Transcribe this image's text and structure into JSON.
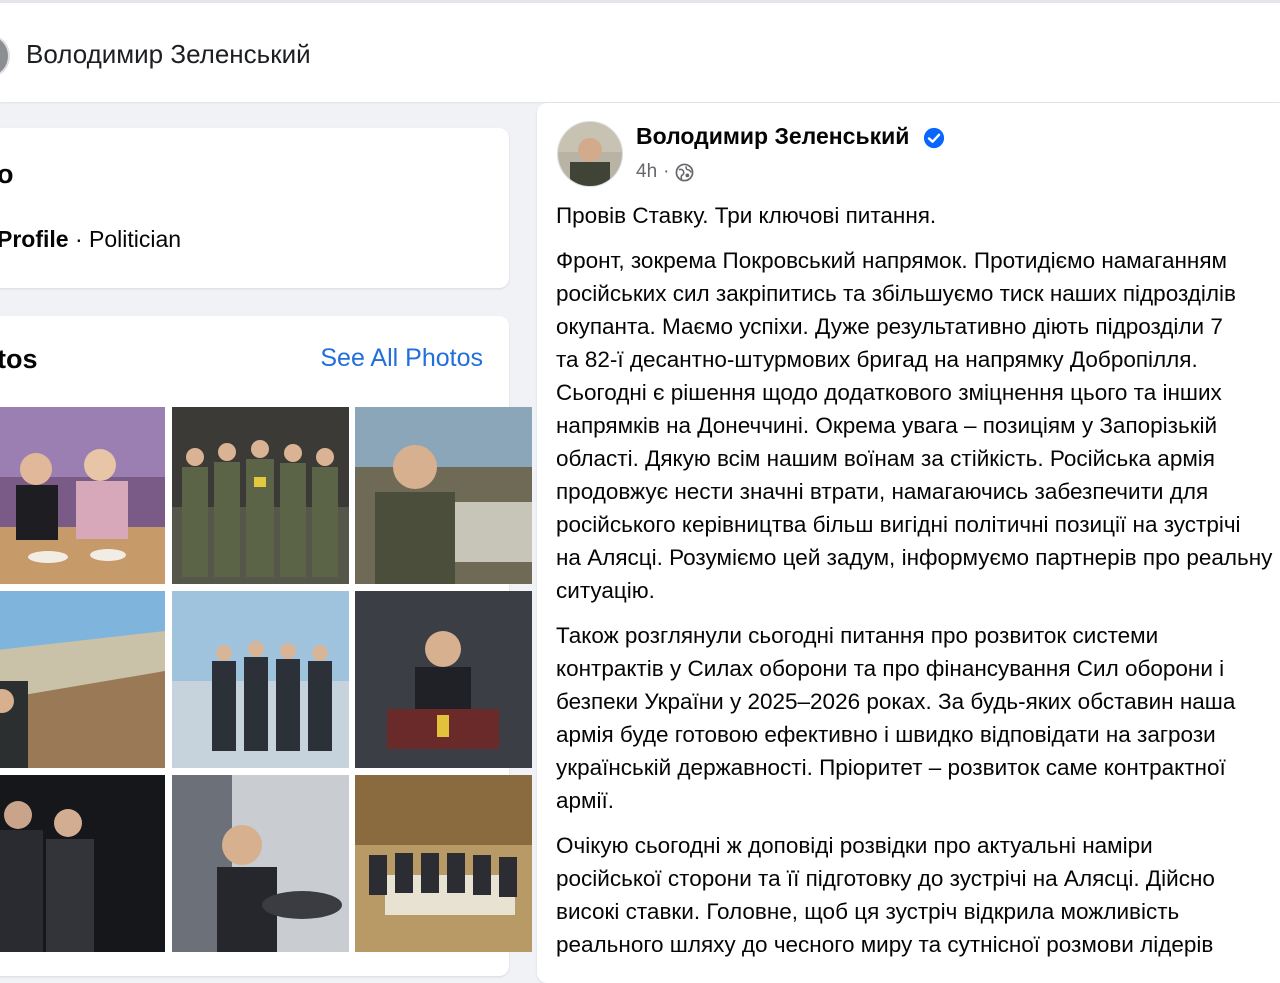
{
  "header": {
    "page_name": "Володимир Зеленський"
  },
  "intro": {
    "heading": "o",
    "profile_type": "Profile",
    "separator": " · ",
    "category": "Politician"
  },
  "photos": {
    "heading": "tos",
    "see_all_label": "See All Photos"
  },
  "post": {
    "author": "Володимир Зеленський",
    "time": "4h",
    "verified_icon": "verified-badge-icon",
    "audience_icon": "globe-icon",
    "accent_color": "#0866ff",
    "paragraphs": [
      [
        "Провів Ставку. Три ключові питання."
      ],
      [
        "Фронт, зокрема Покровський напрямок. Протидіємо намаганням",
        "російських сил закріпитись та збільшуємо тиск наших підрозділів",
        "окупанта. Маємо успіхи. Дуже результативно діють підрозділи 7",
        "та 82-ї десантно-штурмових бригад на напрямку Добропілля.",
        "Сьогодні є рішення щодо додаткового зміцнення цього та інших",
        "напрямків на Донеччині. Окрема увага – позиціям у Запорізькій",
        "області. Дякую всім нашим воїнам за стійкість. Російська армія",
        "продовжує нести значні втрати, намагаючись забезпечити для",
        "російського керівництва більш вигідні політичні позиції на зустрічі",
        "на Алясці. Розуміємо цей задум, інформуємо партнерів про реальну",
        "ситуацію."
      ],
      [
        "Також розглянули сьогодні питання про розвиток системи",
        "контрактів у Силах оборони та про фінансування Сил оборони і",
        "безпеки України у 2025–2026 роках. За будь-яких обставин наша",
        "армія буде готовою ефективно і швидко відповідати на загрози",
        "українській державності. Пріоритет – розвиток саме контрактної",
        "армії."
      ],
      [
        "Очікую сьогодні ж доповіді розвідки про актуальні наміри",
        "російської сторони та її підготовку до зустрічі на Алясці. Дійсно",
        "високі ставки. Головне, щоб ця зустріч відкрила можливість",
        "реального шляху до чесного миру та сутнісної розмови лідерів"
      ]
    ]
  }
}
